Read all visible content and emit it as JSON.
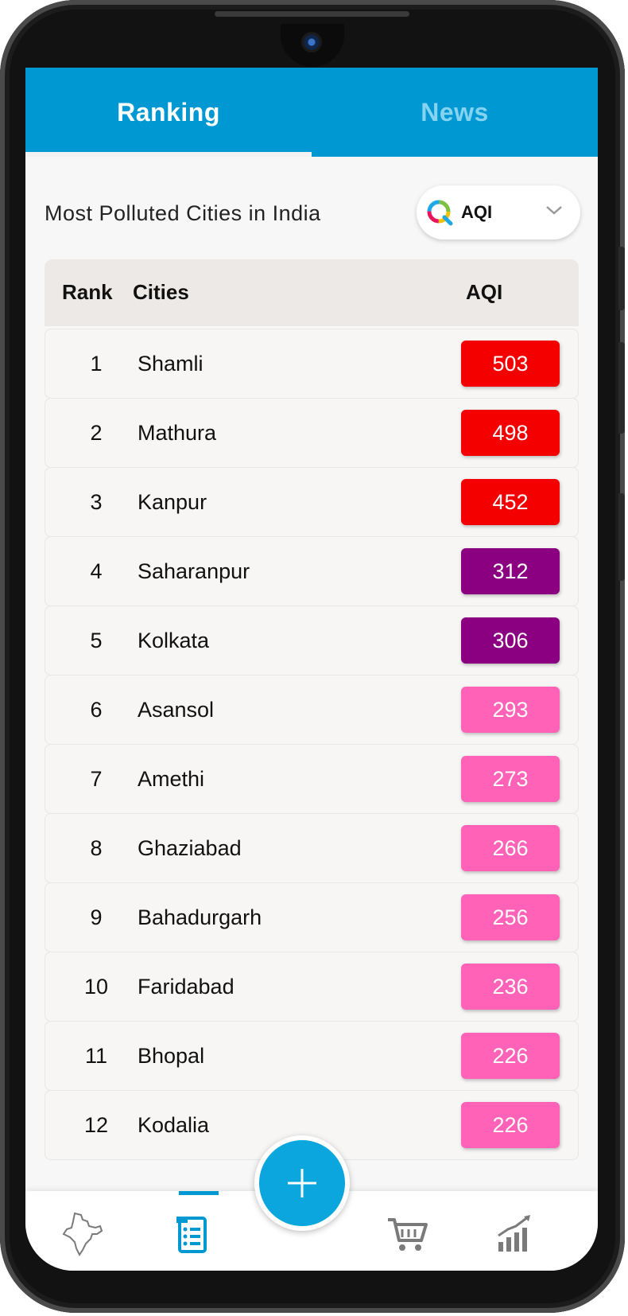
{
  "tabs": {
    "ranking": "Ranking",
    "news": "News"
  },
  "heading": "Most Polluted Cities in India",
  "dropdown": {
    "selected": "AQI"
  },
  "table": {
    "headers": {
      "rank": "Rank",
      "cities": "Cities",
      "aqi": "AQI"
    },
    "rows": [
      {
        "rank": "1",
        "city": "Shamli",
        "aqi": "503",
        "color": "#f50000"
      },
      {
        "rank": "2",
        "city": "Mathura",
        "aqi": "498",
        "color": "#f50000"
      },
      {
        "rank": "3",
        "city": "Kanpur",
        "aqi": "452",
        "color": "#f50000"
      },
      {
        "rank": "4",
        "city": "Saharanpur",
        "aqi": "312",
        "color": "#8a0080"
      },
      {
        "rank": "5",
        "city": "Kolkata",
        "aqi": "306",
        "color": "#8a0080"
      },
      {
        "rank": "6",
        "city": "Asansol",
        "aqi": "293",
        "color": "#ff62b7"
      },
      {
        "rank": "7",
        "city": "Amethi",
        "aqi": "273",
        "color": "#ff62b7"
      },
      {
        "rank": "8",
        "city": "Ghaziabad",
        "aqi": "266",
        "color": "#ff62b7"
      },
      {
        "rank": "9",
        "city": "Bahadurgarh",
        "aqi": "256",
        "color": "#ff62b7"
      },
      {
        "rank": "10",
        "city": "Faridabad",
        "aqi": "236",
        "color": "#ff62b7"
      },
      {
        "rank": "11",
        "city": "Bhopal",
        "aqi": "226",
        "color": "#ff62b7"
      },
      {
        "rank": "12",
        "city": "Kodalia",
        "aqi": "226",
        "color": "#ff62b7"
      }
    ]
  },
  "bottom_nav": {
    "items": [
      "india-map-icon",
      "ranking-list-icon",
      "add-icon",
      "cart-icon",
      "trend-chart-icon"
    ],
    "active": "ranking-list-icon",
    "accent": "#0098d2"
  }
}
